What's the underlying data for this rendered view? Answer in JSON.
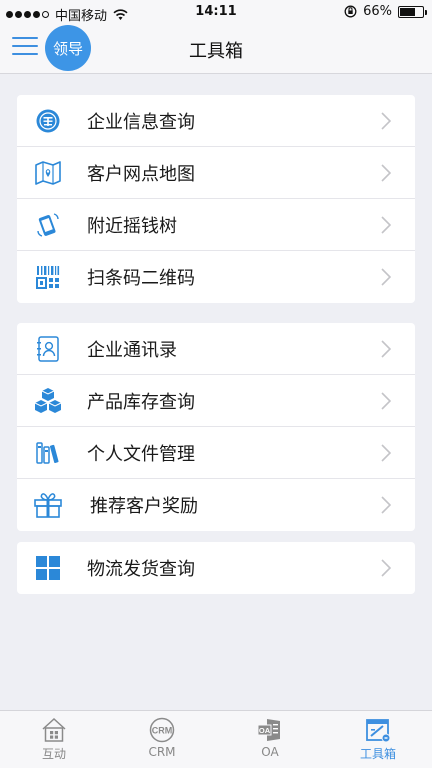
{
  "status_bar": {
    "carrier": "中国移动",
    "time": "14:11",
    "battery_text": "66%",
    "battery_level": 0.66
  },
  "nav": {
    "avatar_text": "领导",
    "title": "工具箱"
  },
  "groups": [
    {
      "items": [
        {
          "label": "企业信息查询",
          "icon": "company-search-icon"
        },
        {
          "label": "客户网点地图",
          "icon": "map-icon"
        },
        {
          "label": "附近摇钱树",
          "icon": "shake-phone-icon"
        },
        {
          "label": "扫条码二维码",
          "icon": "qr-code-icon"
        }
      ]
    },
    {
      "items": [
        {
          "label": "企业通讯录",
          "icon": "contacts-icon"
        },
        {
          "label": "产品库存查询",
          "icon": "inventory-boxes-icon"
        },
        {
          "label": "个人文件管理",
          "icon": "files-icon"
        },
        {
          "label": "推荐客户奖励",
          "icon": "gift-icon"
        }
      ]
    },
    {
      "items": [
        {
          "label": "物流发货查询",
          "icon": "logistics-grid-icon"
        }
      ]
    }
  ],
  "tabs": [
    {
      "label": "互动",
      "icon": "home-icon",
      "active": false
    },
    {
      "label": "CRM",
      "icon": "crm-icon",
      "active": false
    },
    {
      "label": "OA",
      "icon": "oa-icon",
      "active": false
    },
    {
      "label": "工具箱",
      "icon": "toolbox-icon",
      "active": true
    }
  ],
  "colors": {
    "accent": "#3d8fe0",
    "background": "#eeeff4",
    "tab_inactive": "#888888"
  }
}
